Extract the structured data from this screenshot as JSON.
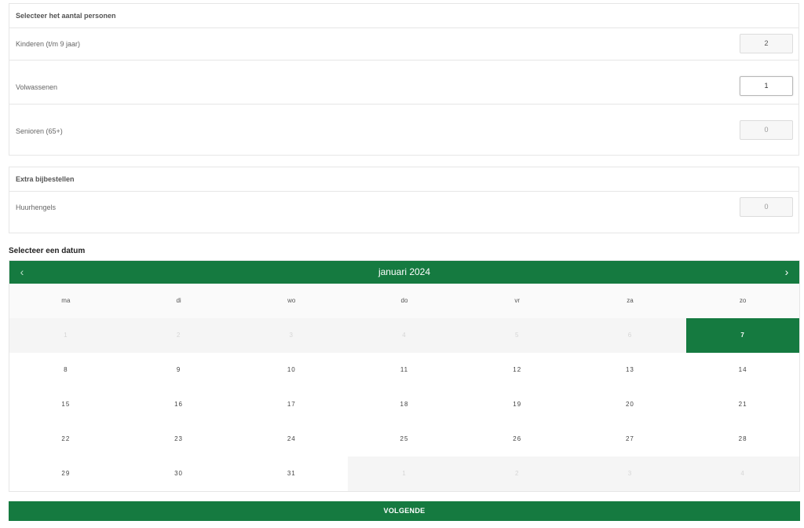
{
  "persons": {
    "header": "Selecteer het aantal personen",
    "rows": [
      {
        "label": "Kinderen (t/m 9 jaar)",
        "value": "2"
      },
      {
        "label": "Volwassenen",
        "value": "1"
      },
      {
        "label": "Senioren (65+)",
        "value": "0"
      }
    ]
  },
  "extras": {
    "header": "Extra bijbestellen",
    "rows": [
      {
        "label": "Huurhengels",
        "value": "0"
      }
    ]
  },
  "calendar": {
    "section_title": "Selecteer een datum",
    "month_label": "januari 2024",
    "prev_icon": "‹",
    "next_icon": "›",
    "weekdays": [
      "ma",
      "di",
      "wo",
      "do",
      "vr",
      "za",
      "zo"
    ],
    "selected_day": "7",
    "days": [
      [
        "1",
        "2",
        "3",
        "4",
        "5",
        "6",
        "7"
      ],
      [
        "8",
        "9",
        "10",
        "11",
        "12",
        "13",
        "14"
      ],
      [
        "15",
        "16",
        "17",
        "18",
        "19",
        "20",
        "21"
      ],
      [
        "22",
        "23",
        "24",
        "25",
        "26",
        "27",
        "28"
      ],
      [
        "29",
        "30",
        "31",
        "1",
        "2",
        "3",
        "4"
      ]
    ]
  },
  "next_button": "VOLGENDE",
  "colors": {
    "accent": "#157a40"
  }
}
